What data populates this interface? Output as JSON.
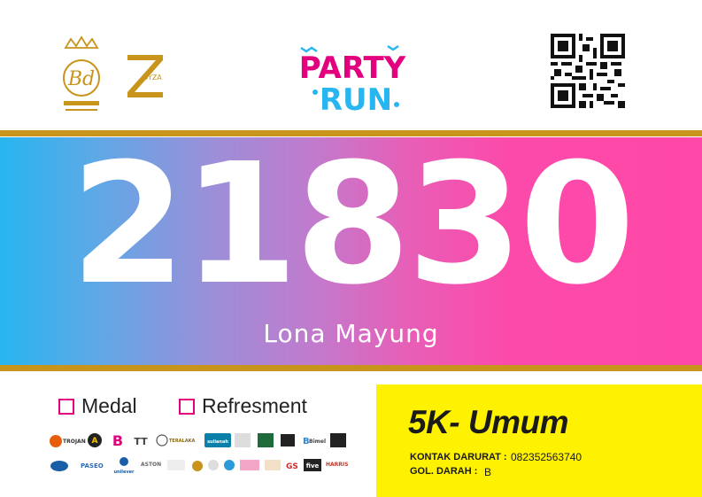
{
  "header": {
    "logos": [
      "bd-belicious-logo",
      "dyza-logo"
    ],
    "event_logo": {
      "line1": "PARTY",
      "line2": "RUN"
    },
    "bd_logo_text": "Bd",
    "dyza_text": "DYZA"
  },
  "bib": {
    "number": "21830",
    "name": "Lona Mayung"
  },
  "checks": {
    "medal": "Medal",
    "refreshment": "Refresment"
  },
  "info": {
    "category": "5K- Umum",
    "contact_label": "KONTAK DARURAT :",
    "contact_value": "082352563740",
    "blood_label": "GOL. DARAH :",
    "blood_value": "B"
  },
  "sponsors": {
    "row1": [
      "TROJAN",
      "A",
      "B",
      "TT",
      "TERALAKA",
      "sulianah",
      "",
      "",
      "",
      "",
      "Bimel",
      ""
    ],
    "row2": [
      "",
      "PASEO",
      "unilever",
      "ASTON",
      "",
      "",
      "",
      "",
      "",
      "GS",
      "five",
      "HARRIS"
    ]
  },
  "colors": {
    "gold": "#c8941c",
    "yellow": "#fff200",
    "pink": "#ff48a8",
    "blue": "#27b6f0",
    "magenta": "#e3007e"
  }
}
